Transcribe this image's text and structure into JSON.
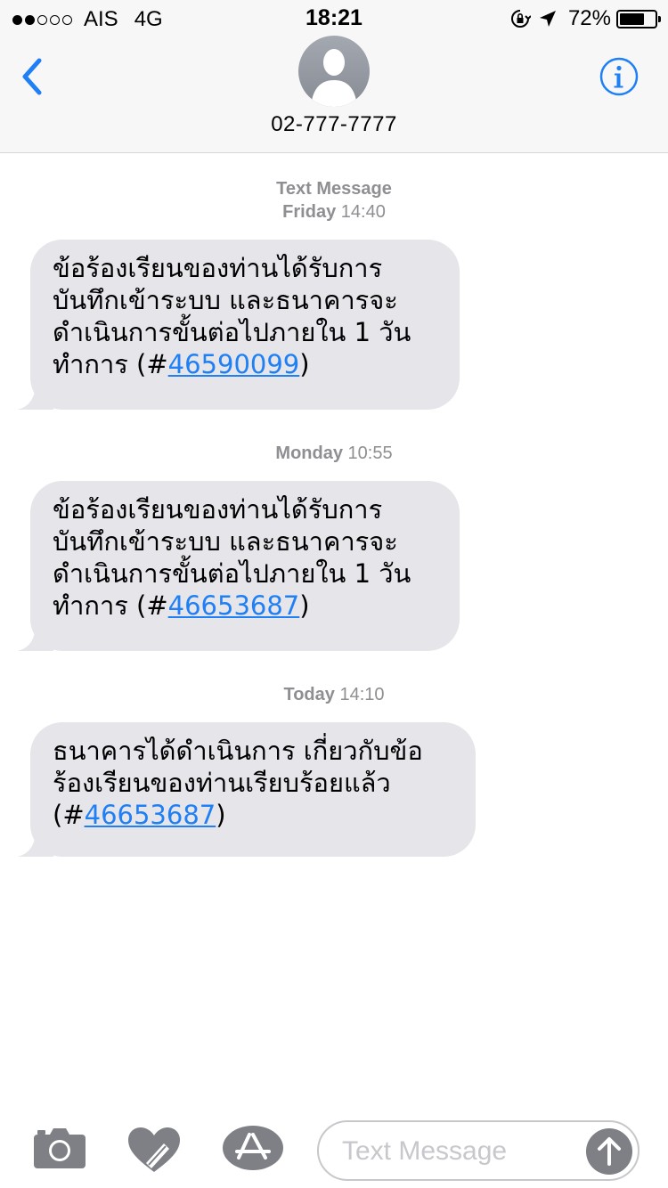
{
  "status_bar": {
    "carrier": "AIS",
    "network": "4G",
    "time": "18:21",
    "battery": "72%",
    "battery_level": 0.72,
    "signal_bars": 2,
    "signal_total": 5
  },
  "header": {
    "contact": "02-777-7777"
  },
  "messages": [
    {
      "timestamp_day": "Text Message",
      "timestamp_day2": "Friday",
      "timestamp_time": "14:40",
      "lines": [
        "ข้อร้องเรียนของท่านได้รับการ",
        "บันทึกเข้าระบบ และธนาคารจะ",
        "ดำเนินการขั้นต่อไปภายใน 1 วัน"
      ],
      "last_prefix": "ทำการ (#",
      "link": "46590099",
      "last_suffix": ")"
    },
    {
      "timestamp_day": "Monday",
      "timestamp_time": "10:55",
      "lines": [
        "ข้อร้องเรียนของท่านได้รับการ",
        "บันทึกเข้าระบบ และธนาคารจะ",
        "ดำเนินการขั้นต่อไปภายใน 1 วัน"
      ],
      "last_prefix": "ทำการ (#",
      "link": "46653687",
      "last_suffix": ")"
    },
    {
      "timestamp_day": "Today",
      "timestamp_time": "14:10",
      "lines": [
        "ธนาคารได้ดำเนินการ เกี่ยวกับข้อ",
        "ร้องเรียนของท่านเรียบร้อยแล้ว"
      ],
      "last_prefix": "(#",
      "link": "46653687",
      "last_suffix": ")"
    }
  ],
  "composer": {
    "placeholder": "Text Message"
  },
  "colors": {
    "accent": "#1f7ff5",
    "bubble": "#e5e5ea",
    "timestamp": "#8e8e93"
  }
}
